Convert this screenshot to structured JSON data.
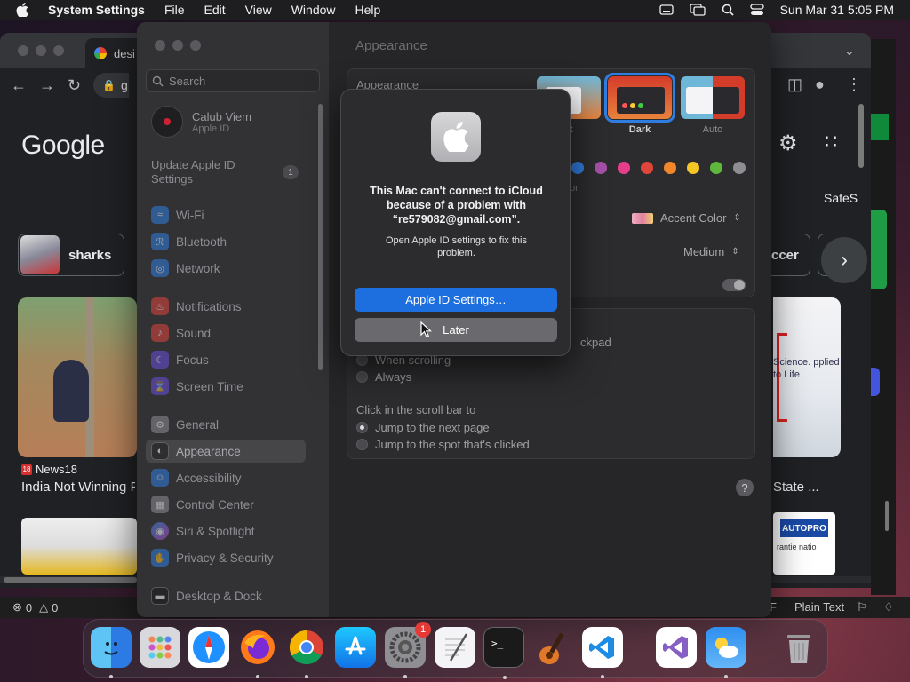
{
  "menubar": {
    "app_name": "System Settings",
    "menus": [
      "File",
      "Edit",
      "View",
      "Window",
      "Help"
    ],
    "datetime": "Sun Mar 31  5:05 PM"
  },
  "browser": {
    "tab_title": "desi",
    "address_text": "g",
    "logo_text": "Google",
    "chip_label": "sharks",
    "chip2_label": "ccer",
    "safesearch_text": "SafeS",
    "news_source": "News18",
    "news_source_badge": "18",
    "news_headline": "India Not Winning Fo",
    "right_headline": "State ...",
    "hockey_text": "Science. pplied to Life",
    "autopro_text": "AUTOPRO",
    "autopro_sub": "rantie natio"
  },
  "statusbar": {
    "problems": "0",
    "warnings": "0",
    "lang_fragment": "F",
    "language": "Plain Text"
  },
  "settings": {
    "search_placeholder": "Search",
    "user_name": "Calub Viem",
    "user_sub": "Apple ID",
    "update_text": "Update Apple ID Settings",
    "update_badge": "1",
    "nav": [
      {
        "label": "Wi-Fi",
        "icon": "wifi-icon",
        "color": "#2f7de1"
      },
      {
        "label": "Bluetooth",
        "icon": "bluetooth-icon",
        "color": "#2f7de1"
      },
      {
        "label": "Network",
        "icon": "globe-icon",
        "color": "#2f7de1"
      },
      {
        "label": "Notifications",
        "icon": "bell-icon",
        "color": "#e0453b"
      },
      {
        "label": "Sound",
        "icon": "speaker-icon",
        "color": "#e0453b"
      },
      {
        "label": "Focus",
        "icon": "moon-icon",
        "color": "#6a4ee0"
      },
      {
        "label": "Screen Time",
        "icon": "hourglass-icon",
        "color": "#6a4ee0"
      },
      {
        "label": "General",
        "icon": "gear-icon",
        "color": "#8e8e92"
      },
      {
        "label": "Appearance",
        "icon": "appearance-icon",
        "color": "#1c1c1e"
      },
      {
        "label": "Accessibility",
        "icon": "accessibility-icon",
        "color": "#2f7de1"
      },
      {
        "label": "Control Center",
        "icon": "control-center-icon",
        "color": "#8e8e92"
      },
      {
        "label": "Siri & Spotlight",
        "icon": "siri-icon",
        "color": "#c04ad0"
      },
      {
        "label": "Privacy & Security",
        "icon": "hand-icon",
        "color": "#2f7de1"
      },
      {
        "label": "Desktop & Dock",
        "icon": "dock-icon",
        "color": "#1c1c1e"
      }
    ],
    "page_title": "Appearance",
    "appearance_label": "Appearance",
    "appearance_options": [
      {
        "label": "nt",
        "selected": false
      },
      {
        "label": "Dark",
        "selected": true
      },
      {
        "label": "Auto",
        "selected": false
      }
    ],
    "accent_fragment": "or",
    "accent_color_label": "Accent Color",
    "sidebar_icon_size": "Medium",
    "scroll_fragment": "ckpad",
    "show_scroll_options": [
      "When scrolling",
      "Always"
    ],
    "click_scroll_label": "Click in the scroll bar to",
    "click_scroll_options": [
      "Jump to the next page",
      "Jump to the spot that's clicked"
    ],
    "help_label": "?",
    "swatch_colors": [
      "#2f7de1",
      "#a550a7",
      "#e63e8c",
      "#e0453b",
      "#f0872a",
      "#f5c626",
      "#5fb83c",
      "#8e8e92"
    ]
  },
  "dialog": {
    "heading": "This Mac can't connect to iCloud because of a problem with “re579082@gmail.com”.",
    "body": "Open Apple ID settings to fix this problem.",
    "primary_button": "Apple ID Settings…",
    "secondary_button": "Later"
  },
  "dock": {
    "items": [
      {
        "name": "finder-icon"
      },
      {
        "name": "launchpad-icon"
      },
      {
        "name": "safari-icon"
      },
      {
        "name": "firefox-icon"
      },
      {
        "name": "chrome-icon"
      },
      {
        "name": "app-store-icon"
      },
      {
        "name": "system-settings-icon",
        "badge": "1"
      },
      {
        "name": "textedit-icon"
      },
      {
        "name": "terminal-icon"
      },
      {
        "name": "garageband-icon"
      },
      {
        "name": "vscode-icon"
      },
      {
        "name": "visual-studio-icon"
      },
      {
        "name": "weather-icon"
      },
      {
        "name": "trash-icon"
      }
    ]
  }
}
